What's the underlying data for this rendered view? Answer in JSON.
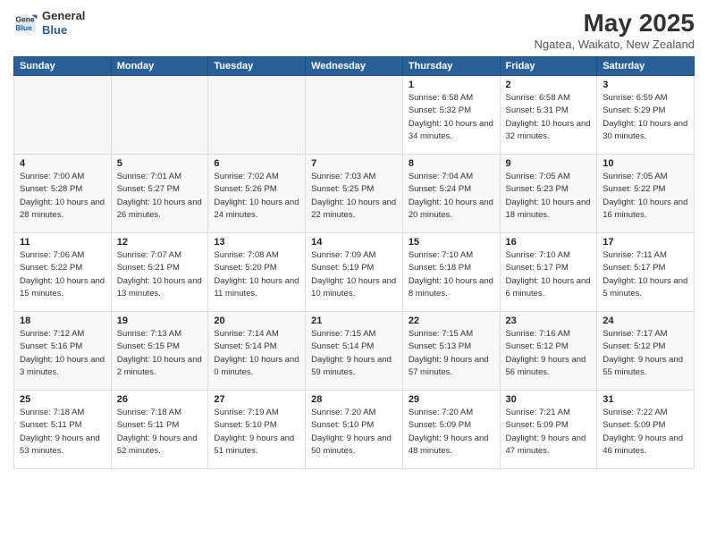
{
  "header": {
    "logo_general": "General",
    "logo_blue": "Blue",
    "month_title": "May 2025",
    "location": "Ngatea, Waikato, New Zealand"
  },
  "weekdays": [
    "Sunday",
    "Monday",
    "Tuesday",
    "Wednesday",
    "Thursday",
    "Friday",
    "Saturday"
  ],
  "weeks": [
    [
      {
        "day": "",
        "empty": true
      },
      {
        "day": "",
        "empty": true
      },
      {
        "day": "",
        "empty": true
      },
      {
        "day": "",
        "empty": true
      },
      {
        "day": "1",
        "sunrise": "6:58 AM",
        "sunset": "5:32 PM",
        "daylight": "10 hours and 34 minutes."
      },
      {
        "day": "2",
        "sunrise": "6:58 AM",
        "sunset": "5:31 PM",
        "daylight": "10 hours and 32 minutes."
      },
      {
        "day": "3",
        "sunrise": "6:59 AM",
        "sunset": "5:29 PM",
        "daylight": "10 hours and 30 minutes."
      }
    ],
    [
      {
        "day": "4",
        "sunrise": "7:00 AM",
        "sunset": "5:28 PM",
        "daylight": "10 hours and 28 minutes."
      },
      {
        "day": "5",
        "sunrise": "7:01 AM",
        "sunset": "5:27 PM",
        "daylight": "10 hours and 26 minutes."
      },
      {
        "day": "6",
        "sunrise": "7:02 AM",
        "sunset": "5:26 PM",
        "daylight": "10 hours and 24 minutes."
      },
      {
        "day": "7",
        "sunrise": "7:03 AM",
        "sunset": "5:25 PM",
        "daylight": "10 hours and 22 minutes."
      },
      {
        "day": "8",
        "sunrise": "7:04 AM",
        "sunset": "5:24 PM",
        "daylight": "10 hours and 20 minutes."
      },
      {
        "day": "9",
        "sunrise": "7:05 AM",
        "sunset": "5:23 PM",
        "daylight": "10 hours and 18 minutes."
      },
      {
        "day": "10",
        "sunrise": "7:05 AM",
        "sunset": "5:22 PM",
        "daylight": "10 hours and 16 minutes."
      }
    ],
    [
      {
        "day": "11",
        "sunrise": "7:06 AM",
        "sunset": "5:22 PM",
        "daylight": "10 hours and 15 minutes."
      },
      {
        "day": "12",
        "sunrise": "7:07 AM",
        "sunset": "5:21 PM",
        "daylight": "10 hours and 13 minutes."
      },
      {
        "day": "13",
        "sunrise": "7:08 AM",
        "sunset": "5:20 PM",
        "daylight": "10 hours and 11 minutes."
      },
      {
        "day": "14",
        "sunrise": "7:09 AM",
        "sunset": "5:19 PM",
        "daylight": "10 hours and 10 minutes."
      },
      {
        "day": "15",
        "sunrise": "7:10 AM",
        "sunset": "5:18 PM",
        "daylight": "10 hours and 8 minutes."
      },
      {
        "day": "16",
        "sunrise": "7:10 AM",
        "sunset": "5:17 PM",
        "daylight": "10 hours and 6 minutes."
      },
      {
        "day": "17",
        "sunrise": "7:11 AM",
        "sunset": "5:17 PM",
        "daylight": "10 hours and 5 minutes."
      }
    ],
    [
      {
        "day": "18",
        "sunrise": "7:12 AM",
        "sunset": "5:16 PM",
        "daylight": "10 hours and 3 minutes."
      },
      {
        "day": "19",
        "sunrise": "7:13 AM",
        "sunset": "5:15 PM",
        "daylight": "10 hours and 2 minutes."
      },
      {
        "day": "20",
        "sunrise": "7:14 AM",
        "sunset": "5:14 PM",
        "daylight": "10 hours and 0 minutes."
      },
      {
        "day": "21",
        "sunrise": "7:15 AM",
        "sunset": "5:14 PM",
        "daylight": "9 hours and 59 minutes."
      },
      {
        "day": "22",
        "sunrise": "7:15 AM",
        "sunset": "5:13 PM",
        "daylight": "9 hours and 57 minutes."
      },
      {
        "day": "23",
        "sunrise": "7:16 AM",
        "sunset": "5:12 PM",
        "daylight": "9 hours and 56 minutes."
      },
      {
        "day": "24",
        "sunrise": "7:17 AM",
        "sunset": "5:12 PM",
        "daylight": "9 hours and 55 minutes."
      }
    ],
    [
      {
        "day": "25",
        "sunrise": "7:18 AM",
        "sunset": "5:11 PM",
        "daylight": "9 hours and 53 minutes."
      },
      {
        "day": "26",
        "sunrise": "7:18 AM",
        "sunset": "5:11 PM",
        "daylight": "9 hours and 52 minutes."
      },
      {
        "day": "27",
        "sunrise": "7:19 AM",
        "sunset": "5:10 PM",
        "daylight": "9 hours and 51 minutes."
      },
      {
        "day": "28",
        "sunrise": "7:20 AM",
        "sunset": "5:10 PM",
        "daylight": "9 hours and 50 minutes."
      },
      {
        "day": "29",
        "sunrise": "7:20 AM",
        "sunset": "5:09 PM",
        "daylight": "9 hours and 48 minutes."
      },
      {
        "day": "30",
        "sunrise": "7:21 AM",
        "sunset": "5:09 PM",
        "daylight": "9 hours and 47 minutes."
      },
      {
        "day": "31",
        "sunrise": "7:22 AM",
        "sunset": "5:09 PM",
        "daylight": "9 hours and 46 minutes."
      }
    ]
  ]
}
